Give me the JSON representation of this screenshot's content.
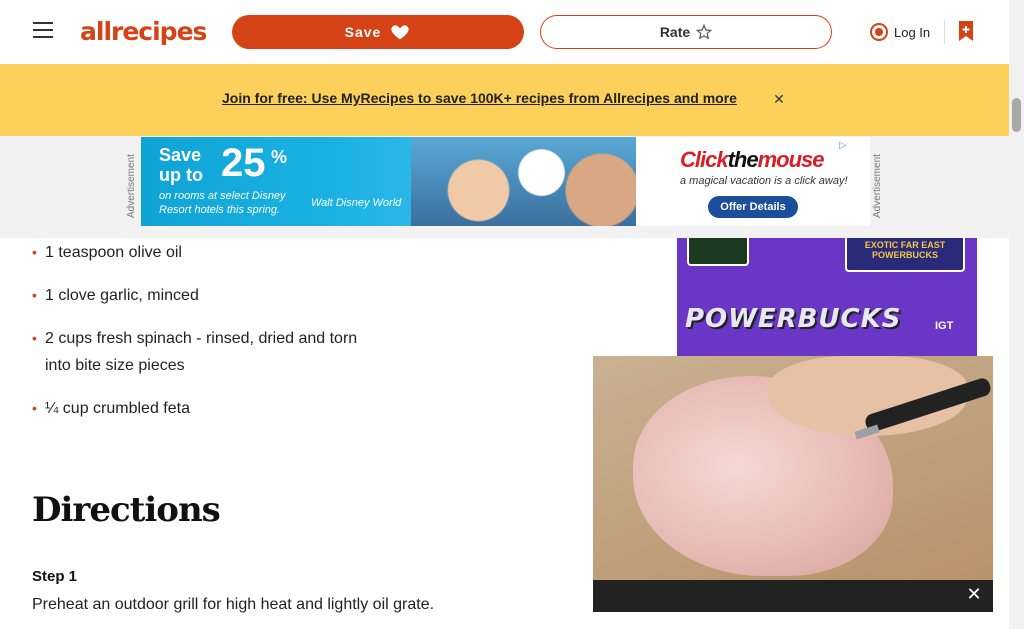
{
  "header": {
    "logo_text": "allrecipes",
    "save_label": "Save",
    "rate_label": "Rate",
    "login_label": "Log In"
  },
  "promo": {
    "link_text": "Join for free: Use MyRecipes to save 100K+ recipes from Allrecipes and more"
  },
  "ad_banner": {
    "label": "Advertisement",
    "headline_1": "Save",
    "headline_2": "up to",
    "percent": "25",
    "percent_sign": "%",
    "body_line_1": "on rooms at select Disney",
    "body_line_2": "Resort hotels this spring.",
    "sponsor": "Walt Disney World",
    "brand_1": "Click",
    "brand_2": "the",
    "brand_3": "mouse",
    "tagline": "a magical vacation is a click away!",
    "offer_button": "Offer Details"
  },
  "ingredients": [
    "1 teaspoon olive oil",
    "1 clove garlic, minced",
    "2 cups fresh spinach - rinsed, dried and torn into bite size pieces",
    "¼ cup crumbled feta"
  ],
  "directions": {
    "heading": "Directions",
    "step_title": "Step 1",
    "step_text": "Preheat an outdoor grill for high heat and lightly oil grate."
  },
  "side_ad": {
    "game_title": "EXOTIC FAR EAST",
    "game_subtitle": "POWERBUCKS",
    "headline": "POWERBUCKS",
    "brand": "IGT"
  },
  "video": {
    "close_icon": "close-icon"
  },
  "colors": {
    "brand": "#d54215",
    "promo_bg": "#fbd15b"
  }
}
